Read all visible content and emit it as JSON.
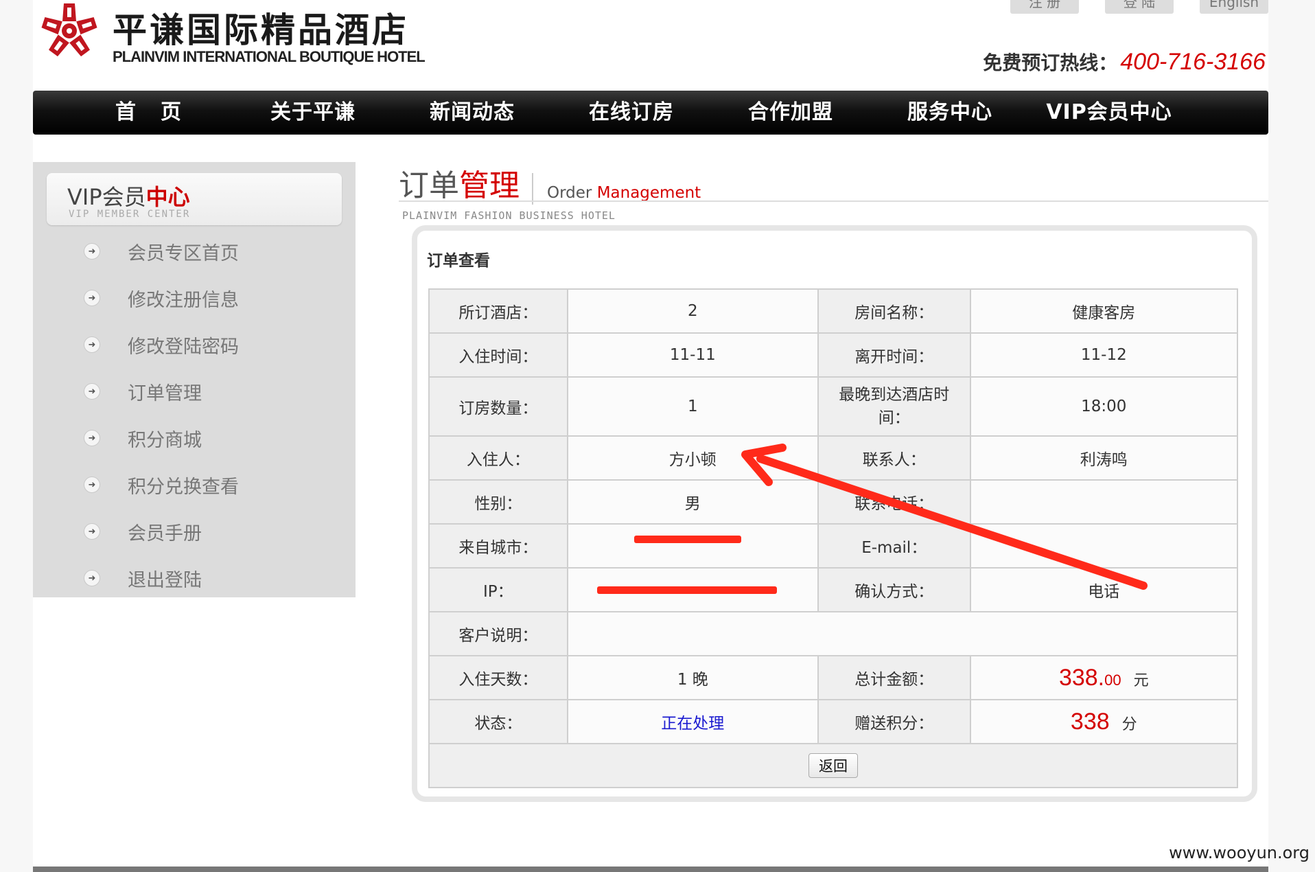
{
  "header": {
    "hotel_name_cn": "平谦国际精品酒店",
    "hotel_name_en": "PLAINVIM INTERNATIONAL BOUTIQUE HOTEL",
    "top_links": [
      "注 册",
      "登 陆",
      "English"
    ],
    "hotline_label": "免费预订热线：",
    "hotline_number": "400-716-3166"
  },
  "nav": {
    "items": [
      "首页",
      "关于平谦",
      "新闻动态",
      "在线订房",
      "合作加盟",
      "服务中心",
      "VIP会员中心"
    ]
  },
  "sidebar": {
    "title_prefix": "VIP会员",
    "title_highlight": "中心",
    "subtitle": "VIP MEMBER CENTER",
    "items": [
      {
        "label": "会员专区首页"
      },
      {
        "label": "修改注册信息"
      },
      {
        "label": "修改登陆密码"
      },
      {
        "label": "订单管理"
      },
      {
        "label": "积分商城"
      },
      {
        "label": "积分兑换查看"
      },
      {
        "label": "会员手册"
      },
      {
        "label": "退出登陆"
      }
    ]
  },
  "section": {
    "title_prefix": "订单",
    "title_highlight": "管理",
    "en_prefix": "Order ",
    "en_highlight": "Management",
    "subtitle": "PLAINVIM FASHION BUSINESS HOTEL"
  },
  "order": {
    "panel_title": "订单查看",
    "hotel_label": "所订酒店：",
    "hotel_value": "2",
    "room_label": "房间名称：",
    "room_value": "健康客房",
    "checkin_label": "入住时间：",
    "checkin_value": "11-11",
    "checkout_label": "离开时间：",
    "checkout_value": "11-12",
    "rooms_label": "订房数量：",
    "rooms_value": "1",
    "arrival_label_line1": "最晚到达酒店时",
    "arrival_label_line2": "间：",
    "arrival_value": "18:00",
    "guest_label": "入住人：",
    "guest_value": "方小顿",
    "contact_label": "联系人：",
    "contact_value": "利涛鸣",
    "gender_label": "性别：",
    "gender_value": "男",
    "phone_label": "联系电话：",
    "phone_value": "",
    "city_label": "来自城市：",
    "email_label": "E-mail：",
    "email_value": "",
    "ip_label": "IP：",
    "confirm_label": "确认方式：",
    "confirm_value": "电话",
    "note_label": "客户说明：",
    "note_value": "",
    "nights_label": "入住天数：",
    "nights_value": "1 晚",
    "total_label": "总计金额：",
    "total_int": "338.",
    "total_dec": "00",
    "total_unit": "元",
    "status_label": "状态：",
    "status_value": "正在处理",
    "points_label": "赠送积分：",
    "points_value": "338",
    "points_unit": "分",
    "back_button": "返回"
  },
  "watermark": "www.wooyun.org",
  "colors": {
    "accent_red": "#d40000",
    "annotation_red": "#ff2a1a",
    "nav_black": "#111111",
    "status_blue": "#1a1ad0"
  }
}
